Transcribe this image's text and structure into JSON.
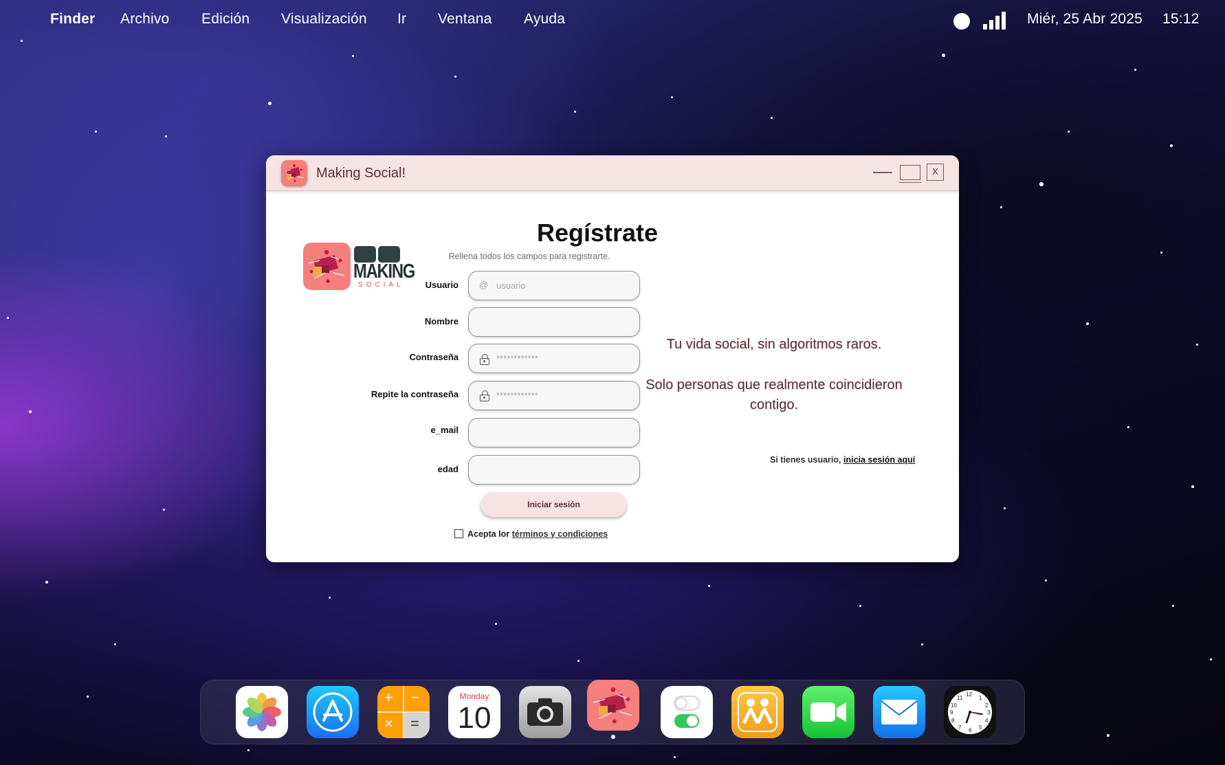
{
  "menubar": {
    "app_name": "Finder",
    "menus": [
      "Archivo",
      "Edición",
      "Visualización",
      "Ir",
      "Ventana",
      "Ayuda"
    ],
    "date": "Miér, 25 Abr 2025",
    "time": "15:12"
  },
  "window": {
    "title": "Making Social!",
    "close_label": "X"
  },
  "logo": {
    "word1": "MAKING",
    "word2": "SOCIAL"
  },
  "form": {
    "title": "Regístrate",
    "subtitle": "Rellena todos los campos para registrarte.",
    "fields": [
      {
        "label": "Usuario",
        "placeholder": "usuario",
        "icon": "at-icon",
        "value": ""
      },
      {
        "label": "Nombre",
        "placeholder": "",
        "icon": "",
        "value": ""
      },
      {
        "label": "Contraseña",
        "placeholder": "************",
        "icon": "lock-icon",
        "value": ""
      },
      {
        "label": "Repite la contraseña",
        "placeholder": "************",
        "icon": "lock-icon",
        "value": ""
      },
      {
        "label": "e_mail",
        "placeholder": "",
        "icon": "",
        "value": ""
      },
      {
        "label": "edad",
        "placeholder": "",
        "icon": "",
        "value": ""
      }
    ],
    "at_symbol": "@",
    "submit_label": "Iniciar sesión",
    "terms_prefix": "Acepta lor",
    "terms_link": "términos y condiciones",
    "terms_checked": false
  },
  "side": {
    "tagline1": "Tu vida social, sin algoritmos raros.",
    "tagline2": "Solo personas que realmente coincidieron contigo.",
    "signin_prefix": "Si tienes usuario,",
    "signin_link": "inicia sesión aquí"
  },
  "dock": {
    "apps": [
      "photos-icon",
      "app-store-icon",
      "calculator-icon",
      "calendar-icon",
      "camera-icon",
      "making-social-icon",
      "settings-toggle-icon",
      "find-my-people-icon",
      "facetime-icon",
      "mail-icon",
      "clock-icon"
    ],
    "calendar_day_name": "Monday",
    "calendar_day_number": "10",
    "calculator_symbols": [
      "+",
      "−",
      "×",
      "="
    ],
    "clock_numbers": [
      "12",
      "1",
      "2",
      "3",
      "4",
      "5",
      "6",
      "7",
      "8",
      "9",
      "10",
      "11"
    ],
    "active_app": "making-social-icon"
  },
  "colors": {
    "titlebar": "#f6e4e5",
    "brand_coral": "#f47f7d",
    "brand_dark": "#2f4143",
    "accent_text": "#5a2e34"
  }
}
